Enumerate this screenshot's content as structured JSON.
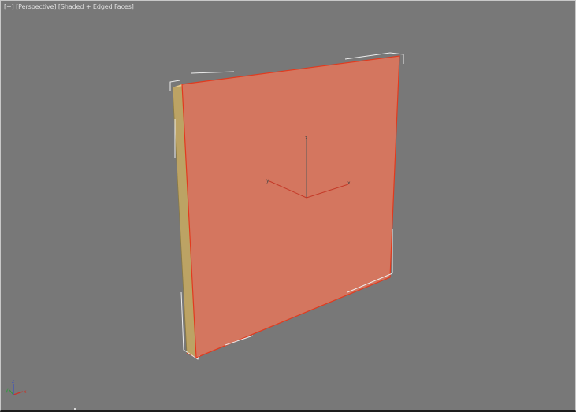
{
  "viewport": {
    "label_plus": "[+]",
    "label_view": "[Perspective]",
    "label_shading": "[Shaded + Edged Faces]"
  },
  "gizmo": {
    "x_label": "x",
    "y_label": "y",
    "z_label": "z"
  },
  "view_cube_axes": {
    "x_label": "x",
    "y_label": "y",
    "z_label": "z"
  },
  "colors": {
    "viewport_background": "#787878",
    "object_front_face": "#d4765f",
    "object_side_face": "#bca364",
    "object_top_face": "#e4c88c",
    "selection_edge": "#e23a1e",
    "bounding_box": "#ececec",
    "gizmo_x": "#c43a28",
    "gizmo_y": "#c43a28",
    "gizmo_z": "#5a5a5a",
    "axis_x": "#c8352a",
    "axis_y": "#2f9a3c",
    "axis_z": "#3d4fbf"
  }
}
